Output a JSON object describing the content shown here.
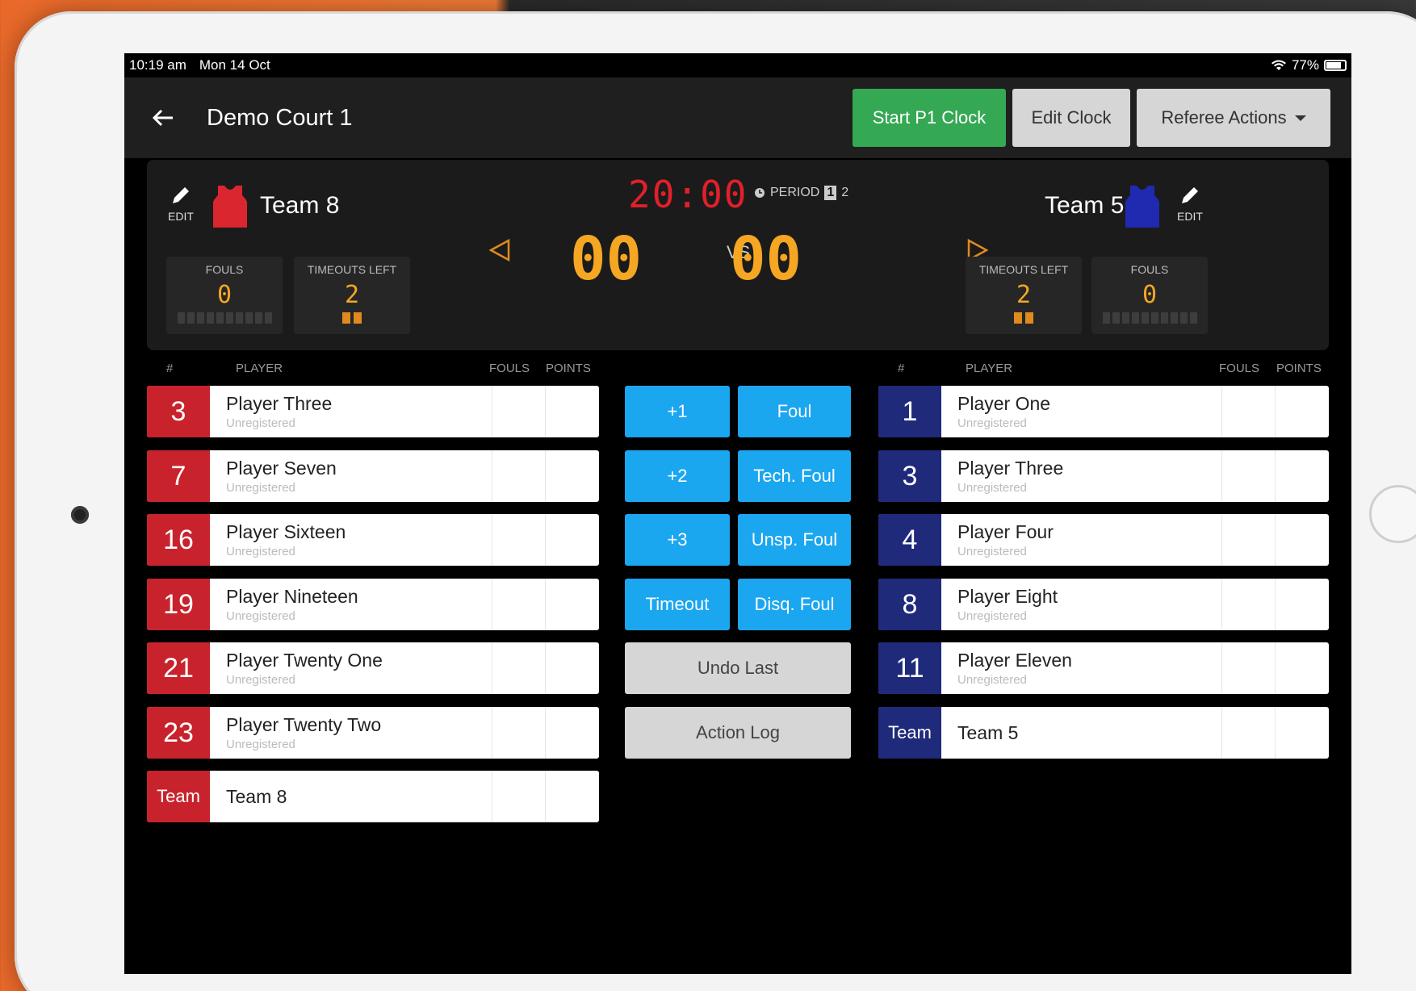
{
  "status": {
    "time": "10:19 am",
    "date": "Mon 14 Oct",
    "battery": "77%"
  },
  "header": {
    "title": "Demo Court 1",
    "start_clock": "Start P1 Clock",
    "edit_clock": "Edit Clock",
    "referee_actions": "Referee Actions"
  },
  "scoreboard": {
    "clock": "20:00",
    "period_label": "PERIOD",
    "period_current": "1",
    "period_total": "2",
    "vs": "VS",
    "home": {
      "name": "Team 8",
      "edit": "EDIT",
      "score": "00",
      "fouls_label": "FOULS",
      "fouls": "0",
      "timeouts_label": "TIMEOUTS LEFT",
      "timeouts": "2",
      "color": "#c8232c"
    },
    "away": {
      "name": "Team 5",
      "edit": "EDIT",
      "score": "00",
      "fouls_label": "FOULS",
      "fouls": "0",
      "timeouts_label": "TIMEOUTS LEFT",
      "timeouts": "2",
      "color": "#1f2ab0"
    }
  },
  "columns": {
    "num": "#",
    "player": "PLAYER",
    "fouls": "FOULS",
    "points": "POINTS"
  },
  "home_roster": [
    {
      "num": "3",
      "name": "Player Three",
      "status": "Unregistered"
    },
    {
      "num": "7",
      "name": "Player Seven",
      "status": "Unregistered"
    },
    {
      "num": "16",
      "name": "Player Sixteen",
      "status": "Unregistered"
    },
    {
      "num": "19",
      "name": "Player Nineteen",
      "status": "Unregistered"
    },
    {
      "num": "21",
      "name": "Player Twenty One",
      "status": "Unregistered"
    },
    {
      "num": "23",
      "name": "Player Twenty Two",
      "status": "Unregistered"
    },
    {
      "num": "Team",
      "name": "Team 8",
      "status": ""
    }
  ],
  "away_roster": [
    {
      "num": "1",
      "name": "Player One",
      "status": "Unregistered"
    },
    {
      "num": "3",
      "name": "Player Three",
      "status": "Unregistered"
    },
    {
      "num": "4",
      "name": "Player Four",
      "status": "Unregistered"
    },
    {
      "num": "8",
      "name": "Player Eight",
      "status": "Unregistered"
    },
    {
      "num": "11",
      "name": "Player Eleven",
      "status": "Unregistered"
    },
    {
      "num": "Team",
      "name": "Team 5",
      "status": ""
    }
  ],
  "actions": {
    "plus1": "+1",
    "foul": "Foul",
    "plus2": "+2",
    "tech_foul": "Tech. Foul",
    "plus3": "+3",
    "unsp_foul": "Unsp. Foul",
    "timeout": "Timeout",
    "disq_foul": "Disq. Foul",
    "undo": "Undo Last",
    "log": "Action Log"
  }
}
